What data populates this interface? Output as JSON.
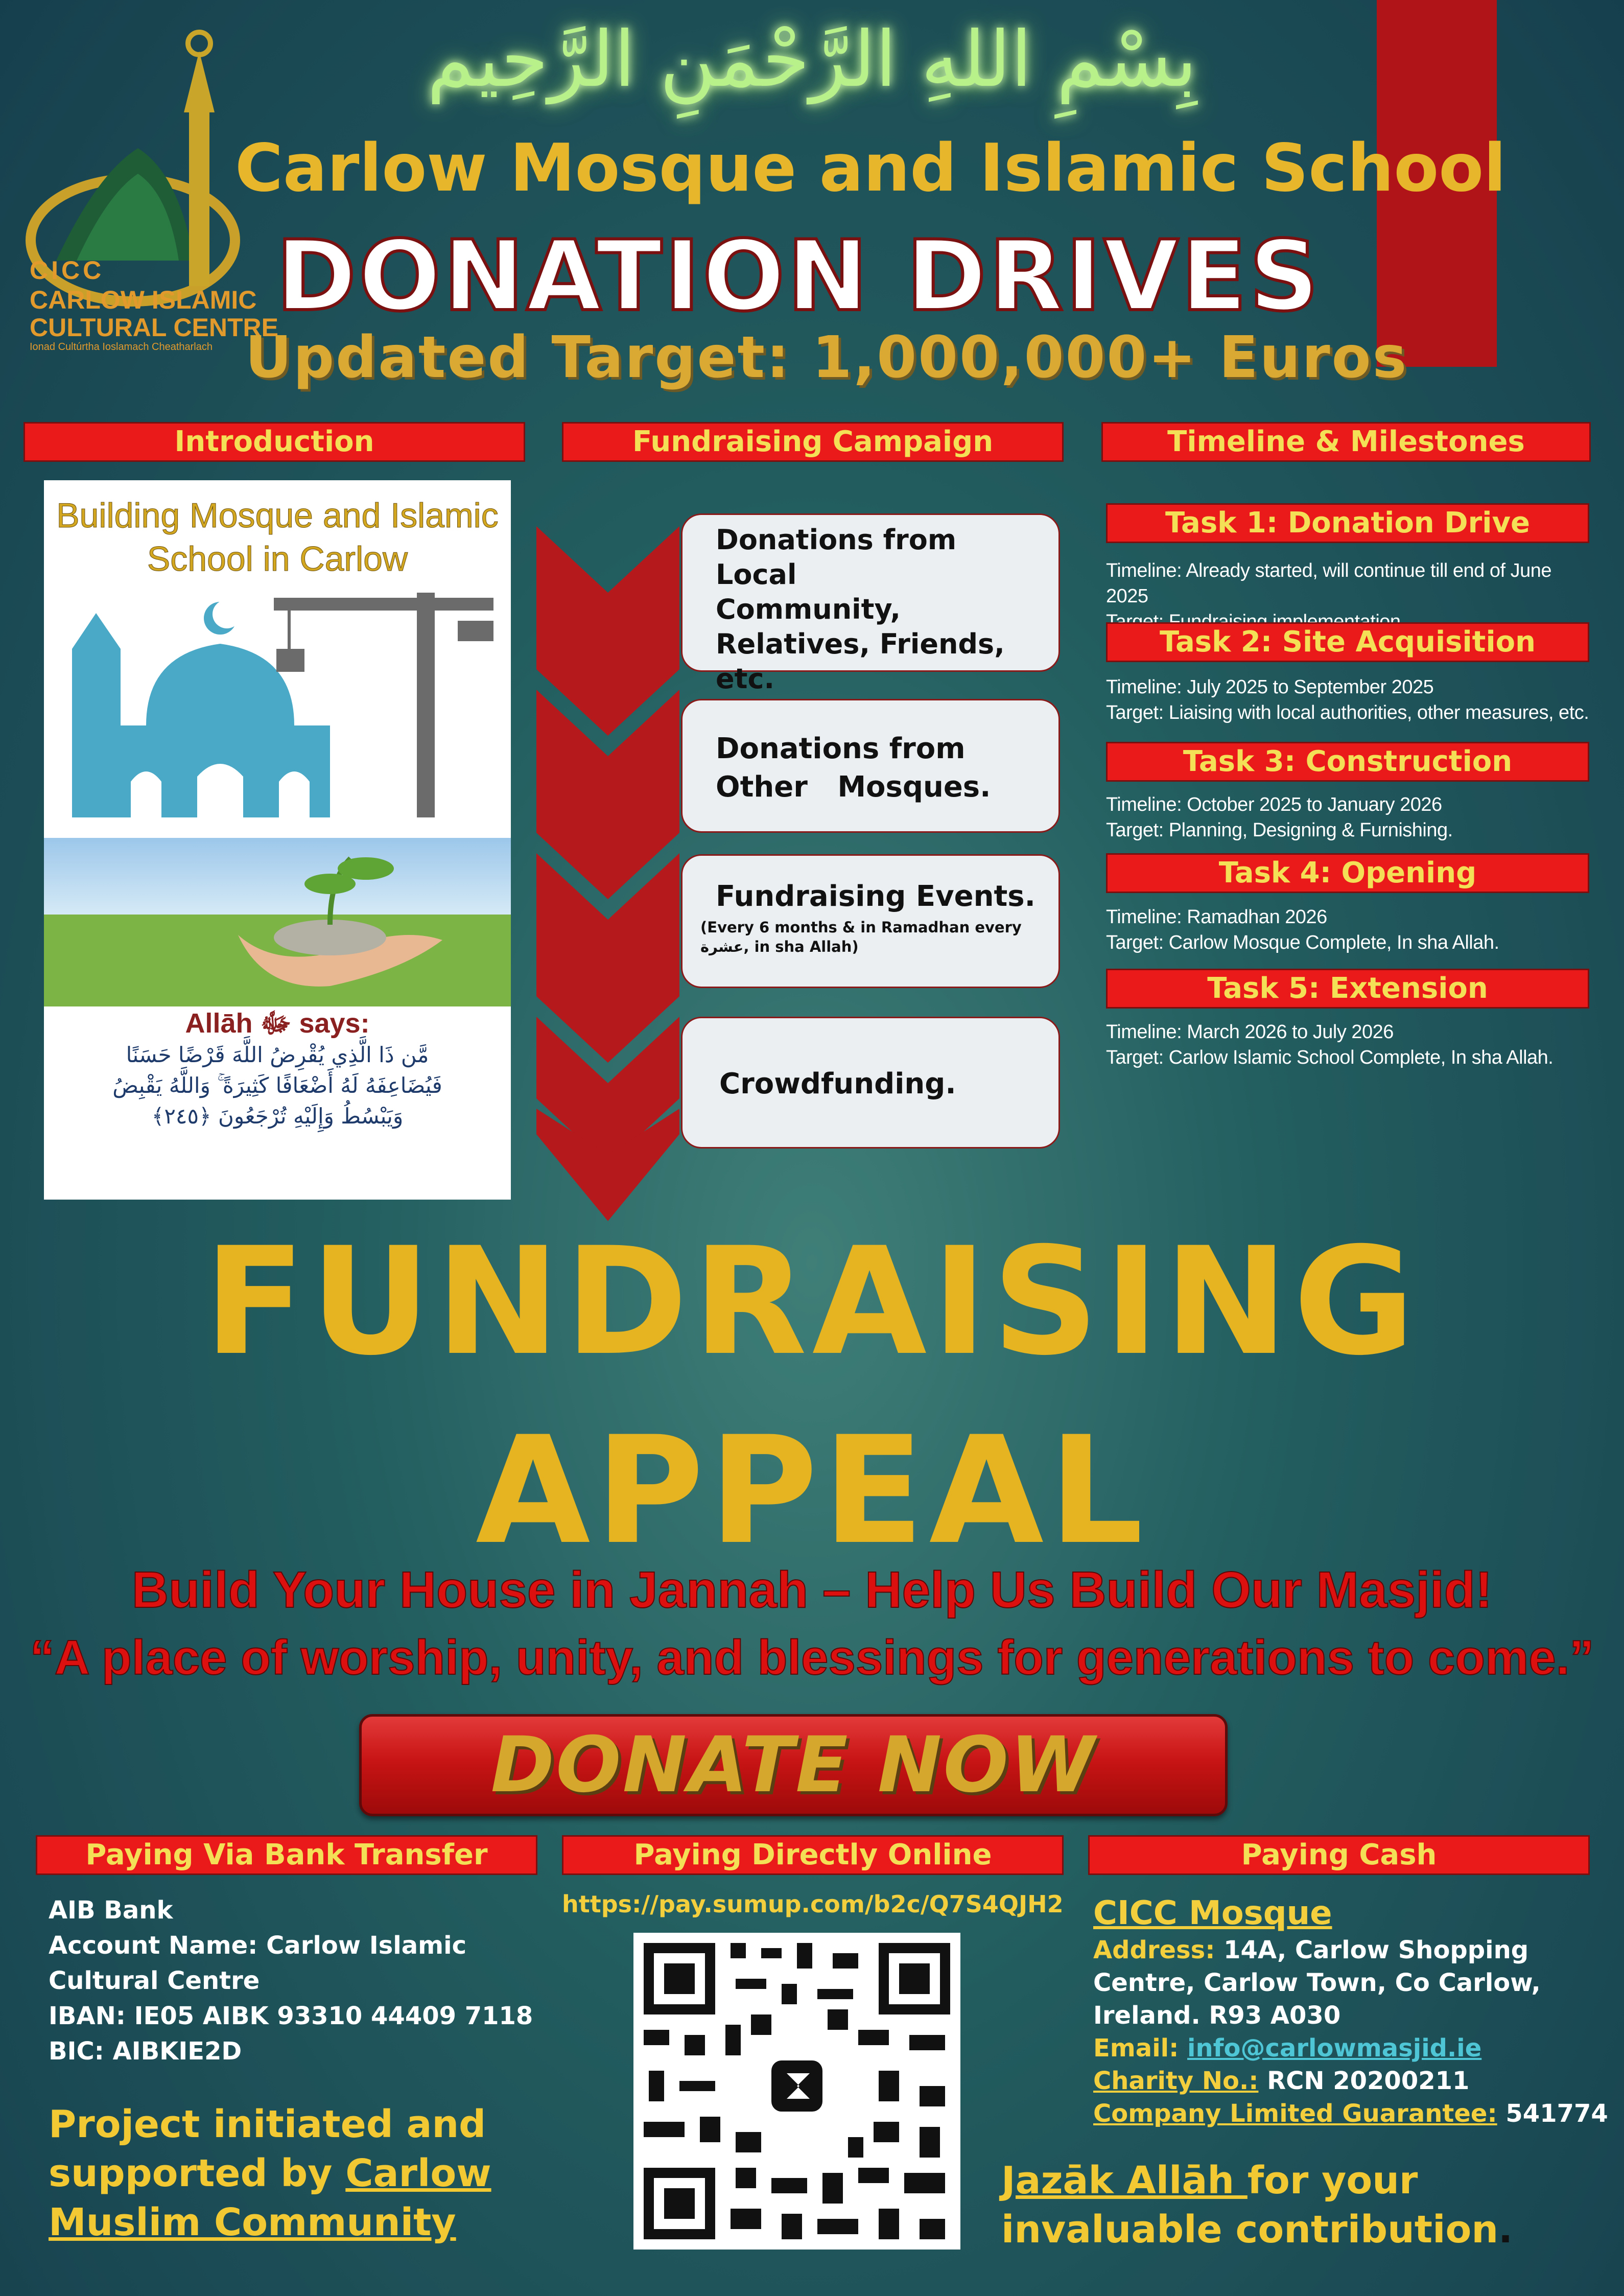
{
  "header": {
    "bismillah": "بِسْمِ اللهِ الرَّحْمَنِ الرَّحِيم",
    "organization": "Carlow Mosque and Islamic School",
    "title": "DONATION DRIVES",
    "target": "Updated Target: 1,000,000+ Euros"
  },
  "logo": {
    "abbrev": "CICC",
    "line1": "CARLOW ISLAMIC",
    "line2": "CULTURAL CENTRE",
    "line3": "Ionad Cultúrtha Ioslamach Cheatharlach"
  },
  "sections": {
    "introduction": "Introduction",
    "campaign": "Fundraising Campaign",
    "timeline": "Timeline & Milestones"
  },
  "intro_panel": {
    "heading_line1": "Building Mosque and Islamic",
    "heading_line2": "School in Carlow",
    "says": "Allāh ﷻ says:",
    "verse_line1": "مَّن ذَا الَّذِي يُقْرِضُ اللَّهَ قَرْضًا حَسَنًا",
    "verse_line2": "فَيُضَاعِفَهُ لَهُ أَضْعَافًا كَثِيرَةً ۚ وَاللَّهُ يَقْبِضُ",
    "verse_line3": "وَيَبْسُطُ وَإِلَيْهِ تُرْجَعُونَ ﴿٢٤٥﴾"
  },
  "campaign": {
    "items": [
      {
        "label_line1": "Donations from Local",
        "label_line2": "Community,",
        "label_line3": "Relatives, Friends,",
        "label_line4": "etc."
      },
      {
        "label_line1": "Donations from",
        "label_line2": "Other   Mosques."
      },
      {
        "label": "Fundraising Events.",
        "note": "(Every 6 months & in Ramadhan every عشرة, in sha Allah)"
      },
      {
        "label": "Crowdfunding."
      }
    ]
  },
  "tasks": [
    {
      "title": "Task 1: Donation Drive",
      "timeline": "Timeline: Already started, will continue till end of June 2025",
      "target": "Target: Fundraising implementation."
    },
    {
      "title": "Task 2: Site Acquisition",
      "timeline": "Timeline: July 2025 to September 2025",
      "target": "Target: Liaising with local authorities, other measures, etc."
    },
    {
      "title": "Task 3: Construction",
      "timeline": "Timeline: October 2025 to January 2026",
      "target": "Target: Planning, Designing & Furnishing."
    },
    {
      "title": "Task 4: Opening",
      "timeline": "Timeline: Ramadhan 2026",
      "target": "Target: Carlow Mosque Complete, In sha Allah."
    },
    {
      "title": "Task 5: Extension",
      "timeline": "Timeline: March 2026 to July 2026",
      "target": "Target: Carlow Islamic School Complete, In sha Allah."
    }
  ],
  "appeal": {
    "line1": "FUNDRAISING",
    "line2": "APPEAL",
    "slogan1": "Build Your House in Jannah – Help Us Build Our Masjid!",
    "slogan2": "“A place of worship, unity, and blessings for generations to come.”",
    "donate_label": "DONATE NOW"
  },
  "payment": {
    "bank_heading": "Paying Via Bank Transfer",
    "online_heading": "Paying Directly Online",
    "cash_heading": "Paying Cash",
    "bank": {
      "bank_name": "AIB Bank",
      "account_line1": "Account Name: Carlow Islamic",
      "account_line2": "Cultural Centre",
      "iban": "IBAN: IE05 AIBK 93310 44409 7118",
      "bic": "BIC: AIBKIE2D"
    },
    "online_url": "https://pay.sumup.com/b2c/Q7S4QJH2",
    "cash": {
      "name": "CICC Mosque",
      "address_label": "Address:",
      "address_line1": "14A, Carlow Shopping",
      "address_line2": "Centre, Carlow Town, Co Carlow,",
      "address_line3": "Ireland. R93 A030",
      "email_label": "Email:",
      "email": "info@carlowmasjid.ie",
      "charity_label": "Charity No.:",
      "charity": "RCN 20200211",
      "company_label": "Company Limited Guarantee:",
      "company": "541774"
    }
  },
  "footer": {
    "project_line1": "Project initiated and",
    "project_line2_a": "supported by ",
    "project_line2_b": "Carlow",
    "project_line3": "Muslim Community",
    "thanks_a": "Jazāk Allāh ",
    "thanks_b": "for your",
    "thanks_line2": "invaluable contribution",
    "thanks_dot": "."
  },
  "colors": {
    "accent_red": "#ea1a1a",
    "gold": "#e6b420",
    "heading_yellow": "#f4e056",
    "background": "#235e60"
  }
}
